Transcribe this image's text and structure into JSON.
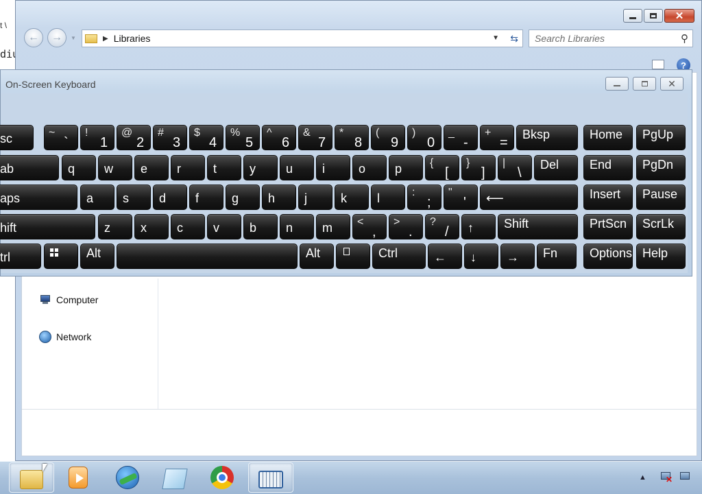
{
  "background_window": {
    "line1": "t \\",
    "line2": "diu"
  },
  "explorer": {
    "address": {
      "location": "Libraries"
    },
    "search": {
      "placeholder": "Search Libraries"
    },
    "nav_pane": {
      "items": [
        {
          "label": "Computer",
          "icon": "computer-icon"
        },
        {
          "label": "Network",
          "icon": "network-icon"
        }
      ]
    }
  },
  "osk": {
    "title": "On-Screen Keyboard",
    "rows": [
      [
        {
          "label": "sc"
        },
        {
          "shift": "~",
          "main": "`"
        },
        {
          "shift": "!",
          "main": "1"
        },
        {
          "shift": "@",
          "main": "2"
        },
        {
          "shift": "#",
          "main": "3"
        },
        {
          "shift": "$",
          "main": "4"
        },
        {
          "shift": "%",
          "main": "5"
        },
        {
          "shift": "^",
          "main": "6"
        },
        {
          "shift": "&",
          "main": "7"
        },
        {
          "shift": "*",
          "main": "8"
        },
        {
          "shift": "(",
          "main": "9"
        },
        {
          "shift": ")",
          "main": "0"
        },
        {
          "shift": "_",
          "main": "-"
        },
        {
          "shift": "+",
          "main": "="
        },
        {
          "label": "Bksp"
        },
        {
          "label": "Home"
        },
        {
          "label": "PgUp"
        }
      ],
      [
        {
          "label": "ab"
        },
        {
          "label": "q"
        },
        {
          "label": "w"
        },
        {
          "label": "e"
        },
        {
          "label": "r"
        },
        {
          "label": "t"
        },
        {
          "label": "y"
        },
        {
          "label": "u"
        },
        {
          "label": "i"
        },
        {
          "label": "o"
        },
        {
          "label": "p"
        },
        {
          "shift": "{",
          "main": "["
        },
        {
          "shift": "}",
          "main": "]"
        },
        {
          "shift": "|",
          "main": "\\"
        },
        {
          "label": "Del"
        },
        {
          "label": "End"
        },
        {
          "label": "PgDn"
        }
      ],
      [
        {
          "label": "aps"
        },
        {
          "label": "a"
        },
        {
          "label": "s"
        },
        {
          "label": "d"
        },
        {
          "label": "f"
        },
        {
          "label": "g"
        },
        {
          "label": "h"
        },
        {
          "label": "j"
        },
        {
          "label": "k"
        },
        {
          "label": "l"
        },
        {
          "shift": ":",
          "main": ";"
        },
        {
          "shift": "\"",
          "main": "'"
        },
        {
          "label": "⟵"
        },
        {
          "label": "Insert"
        },
        {
          "label": "Pause"
        }
      ],
      [
        {
          "label": "hift"
        },
        {
          "label": "z"
        },
        {
          "label": "x"
        },
        {
          "label": "c"
        },
        {
          "label": "v"
        },
        {
          "label": "b"
        },
        {
          "label": "n"
        },
        {
          "label": "m"
        },
        {
          "shift": "<",
          "main": ","
        },
        {
          "shift": ">",
          "main": "."
        },
        {
          "shift": "?",
          "main": "/"
        },
        {
          "label": "↑"
        },
        {
          "label": "Shift"
        },
        {
          "label": "PrtScn"
        },
        {
          "label": "ScrLk"
        }
      ],
      [
        {
          "label": "trl"
        },
        {
          "icon": "windows-logo-icon"
        },
        {
          "label": "Alt"
        },
        {
          "label": ""
        },
        {
          "label": "Alt"
        },
        {
          "icon": "menu-key-icon"
        },
        {
          "label": "Ctrl"
        },
        {
          "label": "←"
        },
        {
          "label": "↓"
        },
        {
          "label": "→"
        },
        {
          "label": "Fn"
        },
        {
          "label": "Options"
        },
        {
          "label": "Help"
        }
      ]
    ]
  },
  "taskbar": {
    "items": [
      {
        "name": "windows-explorer",
        "icon": "folder-icon",
        "active": true
      },
      {
        "name": "media-player",
        "icon": "media-player-icon",
        "active": false
      },
      {
        "name": "download-manager",
        "icon": "globe-download-icon",
        "active": false
      },
      {
        "name": "notepad",
        "icon": "note-icon",
        "active": false
      },
      {
        "name": "chrome",
        "icon": "chrome-icon",
        "active": false
      },
      {
        "name": "on-screen-keyboard",
        "icon": "keyboard-icon",
        "active": true
      }
    ],
    "tray": [
      "show-hidden-icons-arrow-icon",
      "network-disconnected-icon",
      "network-icon"
    ]
  }
}
